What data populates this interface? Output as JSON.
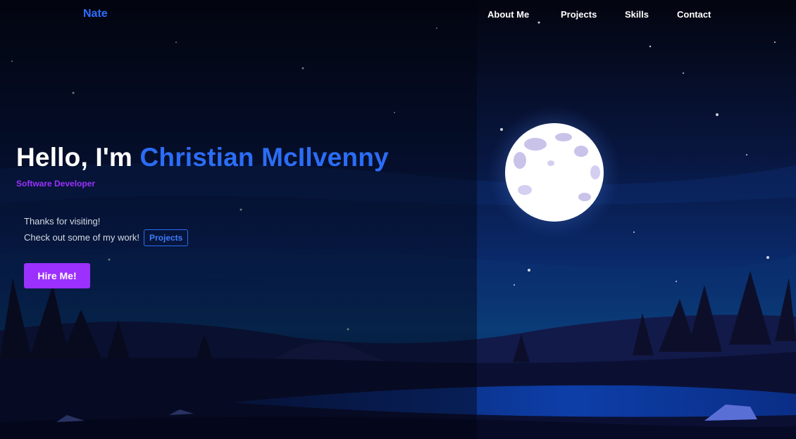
{
  "nav": {
    "brand": "Nate",
    "links": [
      "About Me",
      "Projects",
      "Skills",
      "Contact"
    ]
  },
  "hero": {
    "greeting": "Hello, I'm",
    "name": "Christian McIlvenny",
    "subtitle": "Software Developer",
    "line1": "Thanks for visiting!",
    "line2": "Check out some of my work!",
    "projects_link": "Projects",
    "cta": "Hire Me!"
  },
  "colors": {
    "accent_blue": "#2b6df6",
    "accent_purple": "#9b30ff",
    "sky_dark": "#050818",
    "moon": "#ffffff"
  },
  "background": {
    "scene": "night-landscape",
    "moon_icon": "moon-icon"
  }
}
